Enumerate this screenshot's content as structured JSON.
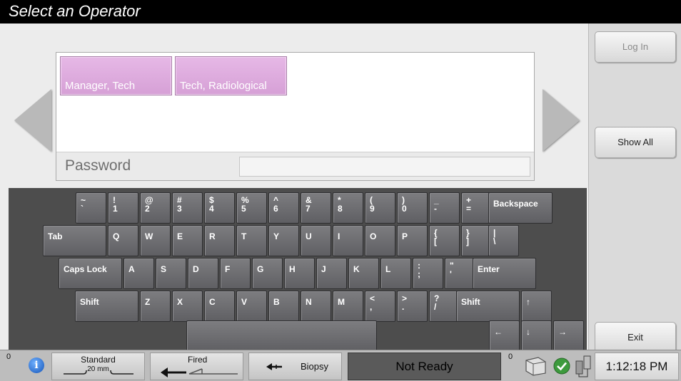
{
  "title": "Select an Operator",
  "operators": [
    "Manager, Tech",
    "Tech, Radiological"
  ],
  "password": {
    "label": "Password",
    "value": ""
  },
  "side_buttons": {
    "login": "Log In",
    "show_all": "Show All",
    "exit": "Exit"
  },
  "keyboard": {
    "row1": [
      {
        "top": "~",
        "bottom": "`"
      },
      {
        "top": "!",
        "bottom": "1"
      },
      {
        "top": "@",
        "bottom": "2"
      },
      {
        "top": "#",
        "bottom": "3"
      },
      {
        "top": "$",
        "bottom": "4"
      },
      {
        "top": "%",
        "bottom": "5"
      },
      {
        "top": "^",
        "bottom": "6"
      },
      {
        "top": "&",
        "bottom": "7"
      },
      {
        "top": "*",
        "bottom": "8"
      },
      {
        "top": "(",
        "bottom": "9"
      },
      {
        "top": ")",
        "bottom": "0"
      },
      {
        "top": "_",
        "bottom": "-"
      },
      {
        "top": "+",
        "bottom": "="
      }
    ],
    "backspace": "Backspace",
    "tab": "Tab",
    "row2": [
      "Q",
      "W",
      "E",
      "R",
      "T",
      "Y",
      "U",
      "I",
      "O",
      "P"
    ],
    "row2_sym": [
      {
        "top": "{",
        "bottom": "["
      },
      {
        "top": "}",
        "bottom": "]"
      },
      {
        "top": "|",
        "bottom": "\\"
      }
    ],
    "caps_lock": "Caps Lock",
    "row3": [
      "A",
      "S",
      "D",
      "F",
      "G",
      "H",
      "J",
      "K",
      "L"
    ],
    "row3_sym": [
      {
        "top": ":",
        "bottom": ";"
      },
      {
        "top": "\"",
        "bottom": "'"
      }
    ],
    "enter": "Enter",
    "shift": "Shift",
    "row4": [
      "Z",
      "X",
      "C",
      "V",
      "B",
      "N",
      "M"
    ],
    "row4_sym": [
      {
        "top": "<",
        "bottom": ","
      },
      {
        "top": ">",
        "bottom": "."
      },
      {
        "top": "?",
        "bottom": "/"
      }
    ],
    "arrows": {
      "up": "↑",
      "left": "←",
      "down": "↓",
      "right": "→"
    }
  },
  "status": {
    "count_left": "0",
    "info_icon_glyph": "i",
    "paddle_line1": "Standard",
    "paddle_line2": "20 mm",
    "fired_label": "Fired",
    "biopsy_label": "Biopsy",
    "state": "Not Ready",
    "count_right": "0",
    "time": "1:12:18 PM"
  }
}
